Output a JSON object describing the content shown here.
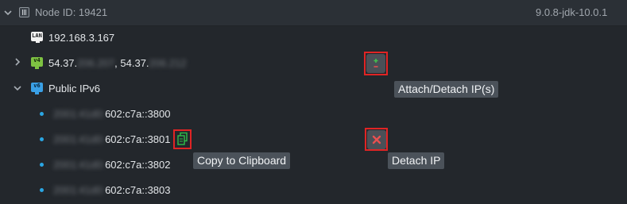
{
  "node": {
    "title": "Node ID: 19421",
    "version": "9.0.8-jdk-10.0.1",
    "icon": "node-icon"
  },
  "lan": {
    "ip": "192.168.3.167",
    "icon_label": "LAN"
  },
  "public_ipv4": {
    "icon_label": "v4",
    "ip1_prefix": "54.37.",
    "ip1_hidden": "206.207",
    "separator": ", ",
    "ip2_prefix": "54.37.",
    "ip2_hidden": "206.212"
  },
  "public_ipv6": {
    "label": "Public IPv6",
    "icon_label": "v6",
    "addresses": [
      {
        "hidden": "2001:41d0:",
        "visible": "602:c7a::3800"
      },
      {
        "hidden": "2001:41d0:",
        "visible": "602:c7a::3801"
      },
      {
        "hidden": "2001:41d0:",
        "visible": "602:c7a::3802"
      },
      {
        "hidden": "2001:41d0:",
        "visible": "602:c7a::3803"
      }
    ]
  },
  "tooltips": {
    "attach_detach": "Attach/Detach IP(s)",
    "copy": "Copy to Clipboard",
    "detach": "Detach IP"
  },
  "colors": {
    "highlight": "#e02424",
    "copy_icon": "#2fbf4a",
    "detach_icon": "#e85050",
    "attach_plus": "#43c24e",
    "attach_minus": "#e05050",
    "bullet": "#2aa6e3"
  }
}
